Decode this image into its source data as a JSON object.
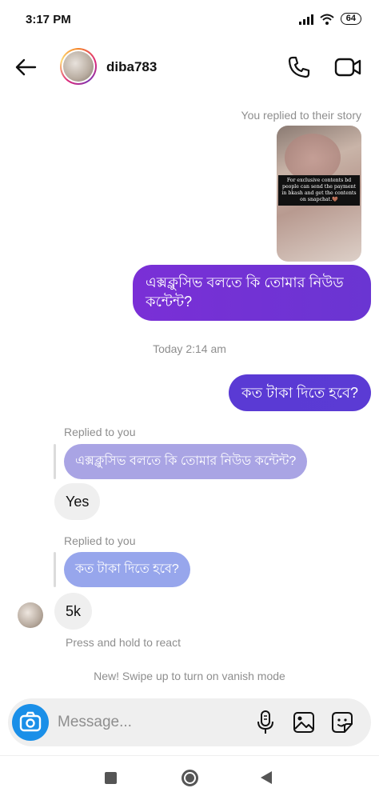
{
  "status_bar": {
    "time": "3:17 PM",
    "battery": "64"
  },
  "header": {
    "username": "diba783"
  },
  "chat": {
    "story_reply_note": "You replied to their story",
    "story_caption": "For exclusive contents bd people can send the payment in bkash and get the contents on snapchat.🤎",
    "sent_message_1": "এক্সক্লুসিভ বলতে কি তোমার নিউড কন্টেন্ট?",
    "timestamp": "Today 2:14 am",
    "sent_message_2": "কত টাকা দিতে হবে?",
    "reply_label_1": "Replied to you",
    "quoted_message_1": "এক্সক্লুসিভ বলতে কি তোমার নিউড কন্টেন্ট?",
    "received_message_1": "Yes",
    "reply_label_2": "Replied to you",
    "quoted_message_2": "কত টাকা দিতে হবে?",
    "received_message_2": "5k",
    "react_hint": "Press and hold to react",
    "vanish_hint": "New! Swipe up to turn on vanish mode"
  },
  "composer": {
    "placeholder": "Message..."
  },
  "icons": {
    "back": "arrow-left-icon",
    "call": "phone-icon",
    "video": "video-camera-icon",
    "camera": "camera-icon",
    "mic": "microphone-icon",
    "gallery": "image-icon",
    "sticker": "sticker-icon"
  },
  "colors": {
    "sent_bubble_start": "#7a2fd6",
    "sent_bubble_end": "#5b3bd4",
    "camera_button": "#1a8fe8",
    "received_bubble": "#efefef"
  }
}
